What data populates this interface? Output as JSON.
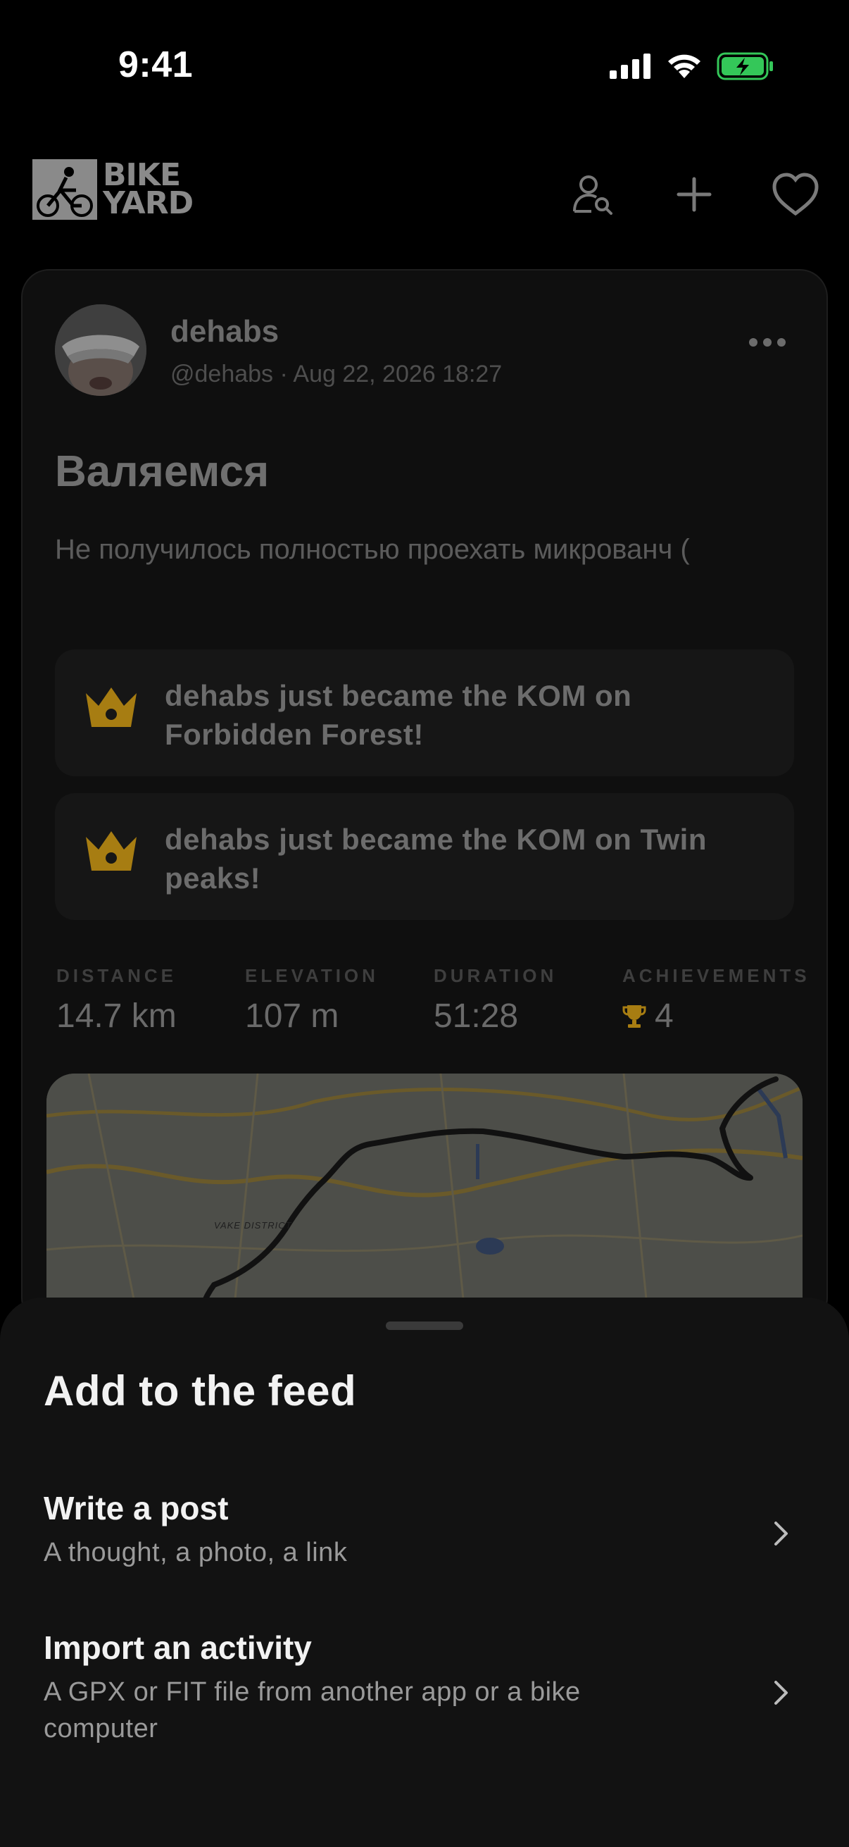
{
  "status_bar": {
    "time": "9:41"
  },
  "header": {
    "logo_line1": "BIKE",
    "logo_line2": "YARD",
    "icons": [
      "find-people-icon",
      "plus-icon",
      "heart-icon"
    ]
  },
  "post": {
    "author_name": "dehabs",
    "author_meta": "@dehabs · Aug 22, 2026 18:27",
    "title": "Валяемся",
    "body": "Не получилось полностью проехать микрованч (",
    "achievements": [
      {
        "text": "dehabs just became the KOM on Forbidden Forest!"
      },
      {
        "text": "dehabs just became the KOM on Twin peaks!"
      }
    ],
    "stats": [
      {
        "label": "DISTANCE",
        "value": "14.7 km"
      },
      {
        "label": "ELEVATION",
        "value": "107 m"
      },
      {
        "label": "DURATION",
        "value": "51:28"
      },
      {
        "label": "ACHIEVEMENTS",
        "value": "4"
      }
    ],
    "map_label": "VAKE DISTRICT"
  },
  "sheet": {
    "title": "Add to the feed",
    "items": [
      {
        "title": "Write a post",
        "subtitle": "A thought, a photo, a link"
      },
      {
        "title": "Import an activity",
        "subtitle": "A GPX or FIT file from another app or a bike computer"
      }
    ]
  },
  "colors": {
    "accent_gold": "#a77d12",
    "battery_green": "#34c759",
    "background": "#000000",
    "sheet": "#121212"
  }
}
